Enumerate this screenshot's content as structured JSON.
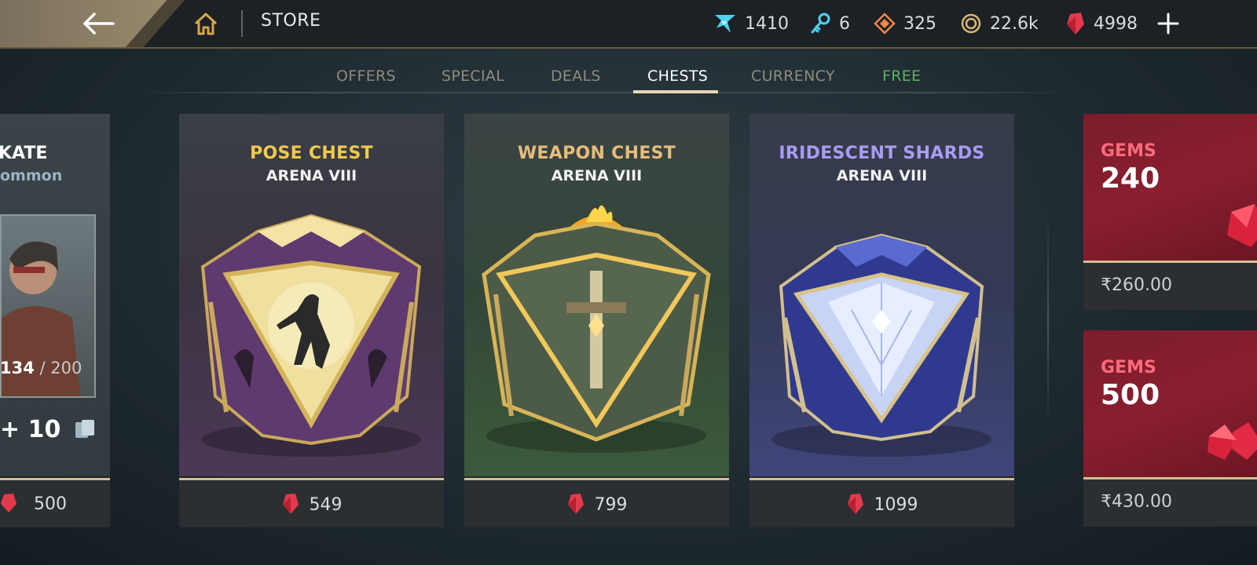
{
  "header": {
    "title": "STORE",
    "currencies": [
      {
        "icon": "crystal-icon",
        "value": "1410",
        "color": "#4fd1f0"
      },
      {
        "icon": "key-icon",
        "value": "6",
        "color": "#4fd1f0"
      },
      {
        "icon": "diamond-token-icon",
        "value": "325",
        "color": "#f0884a"
      },
      {
        "icon": "coin-icon",
        "value": "22.6k",
        "color": "#d9b773"
      },
      {
        "icon": "gem-icon",
        "value": "4998",
        "color": "#e23a4c"
      }
    ]
  },
  "tabs": [
    {
      "label": "OFFERS",
      "active": false
    },
    {
      "label": "SPECIAL",
      "active": false
    },
    {
      "label": "DEALS",
      "active": false
    },
    {
      "label": "CHESTS",
      "active": true
    },
    {
      "label": "CURRENCY",
      "active": false
    },
    {
      "label": "FREE",
      "active": false
    }
  ],
  "skate_card": {
    "title": "KATE",
    "rarity": "ommon",
    "progress_current": "134",
    "progress_total": "/ 200",
    "reward": "10",
    "price": "500"
  },
  "chests": [
    {
      "title": "POSE CHEST",
      "subtitle": "ARENA VIII",
      "price": "549",
      "title_color": "#f2c94c"
    },
    {
      "title": "WEAPON CHEST",
      "subtitle": "ARENA VIII",
      "price": "799",
      "title_color": "#e7bd7a"
    },
    {
      "title": "IRIDESCENT SHARDS",
      "subtitle": "ARENA VIII",
      "price": "1099",
      "title_color": "#a99cf4"
    }
  ],
  "gem_packs": [
    {
      "label": "GEMS",
      "amount": "240",
      "price": "₹260.00"
    },
    {
      "label": "GEMS",
      "amount": "500",
      "price": "₹430.00"
    }
  ]
}
